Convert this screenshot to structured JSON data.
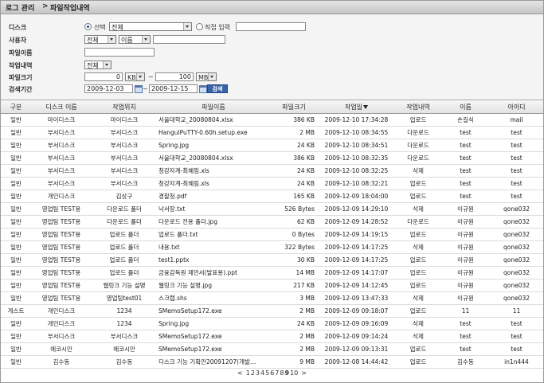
{
  "breadcrumb": {
    "parent": "로그 관리",
    "separator": ">",
    "current": "파일작업내역"
  },
  "filters": {
    "disk": {
      "label": "디스크",
      "radio_select_label": "선택",
      "select_value": "전체",
      "radio_direct_label": "직접 입력",
      "direct_value": ""
    },
    "user": {
      "label": "사용자",
      "scope_value": "전체",
      "field_value": "이름",
      "value": ""
    },
    "filename": {
      "label": "파일이름",
      "value": ""
    },
    "action": {
      "label": "작업내역",
      "value": "전체"
    },
    "filesize": {
      "label": "파일크기",
      "min": "0",
      "min_unit": "KB",
      "tilde": "~",
      "max": "100",
      "max_unit": "MB"
    },
    "period": {
      "label": "검색기간",
      "from": "2009-12-03",
      "tilde": "~",
      "to": "2009-12-15",
      "search_button": "검색"
    }
  },
  "table": {
    "columns": [
      "구분",
      "디스크 이름",
      "작업위치",
      "파일이름",
      "파일크기",
      "작업일",
      "작업내역",
      "이름",
      "아이디"
    ],
    "sort_column": "작업일",
    "sort_direction": "descending",
    "rows": [
      [
        "일반",
        "마이디스크",
        "마이디스크",
        "서울대학교_20080804.xlsx",
        "386 KB",
        "2009-12-10 17:34:28",
        "업로드",
        "손길식",
        "mail"
      ],
      [
        "일반",
        "부서디스크",
        "부서디스크",
        "HangulPuTTY-0.60h.setup.exe",
        "2 MB",
        "2009-12-10 08:34:55",
        "다운로드",
        "test",
        "test"
      ],
      [
        "일반",
        "부서디스크",
        "부서디스크",
        "Spring.jpg",
        "24 KB",
        "2009-12-10 08:34:51",
        "다운로드",
        "test",
        "test"
      ],
      [
        "일반",
        "부서디스크",
        "부서디스크",
        "서울대학교_20080804.xlsx",
        "386 KB",
        "2009-12-10 08:32:35",
        "다운로드",
        "test",
        "test"
      ],
      [
        "일반",
        "부서디스크",
        "부서디스크",
        "청강자계-최혜림.xls",
        "24 KB",
        "2009-12-10 08:32:25",
        "삭제",
        "test",
        "test"
      ],
      [
        "일반",
        "부서디스크",
        "부서디스크",
        "청강자계-최혜림.xls",
        "24 KB",
        "2009-12-10 08:32:21",
        "업로드",
        "test",
        "test"
      ],
      [
        "일반",
        "개인디스크",
        "김상구",
        "경찰청.pdf",
        "165 KB",
        "2009-12-09 18:04:00",
        "업로드",
        "test",
        "test"
      ],
      [
        "일반",
        "영업팀 TEST용",
        "다운로드 폴더",
        "낙서장.txt",
        "526 Bytes",
        "2009-12-09 14:29:10",
        "삭제",
        "이규원",
        "qone032"
      ],
      [
        "일반",
        "영업팀 TEST용",
        "다운로드 폴더",
        "다운로드 전용 폴더.jpg",
        "62 KB",
        "2009-12-09 14:28:52",
        "다운로드",
        "이규원",
        "qone032"
      ],
      [
        "일반",
        "영업팀 TEST용",
        "업로드 폴더",
        "업로드 폴더.txt",
        "0 Bytes",
        "2009-12-09 14:19:15",
        "업로드",
        "이규원",
        "qone032"
      ],
      [
        "일반",
        "영업팀 TEST용",
        "업로드 폴더",
        "내용.txt",
        "322 Bytes",
        "2009-12-09 14:17:25",
        "삭제",
        "이규원",
        "qone032"
      ],
      [
        "일반",
        "영업팀 TEST용",
        "업로드 폴더",
        "test1.pptx",
        "30 KB",
        "2009-12-09 14:17:25",
        "업로드",
        "이규원",
        "qone032"
      ],
      [
        "일반",
        "영업팀 TEST용",
        "업로드 폴더",
        "금융감독원 제안서(발표용).ppt",
        "14 MB",
        "2009-12-09 14:17:07",
        "업로드",
        "이규원",
        "qone032"
      ],
      [
        "일반",
        "영업팀 TEST용",
        "웹링크 기능 설명",
        "웹링크 기능 설명.jpg",
        "217 KB",
        "2009-12-09 14:12:45",
        "업로드",
        "이규원",
        "qone032"
      ],
      [
        "일반",
        "영업팀 TEST용",
        "영업팀test01",
        "스크랩.shs",
        "3 MB",
        "2009-12-09 13:47:33",
        "삭제",
        "이규원",
        "qone032"
      ],
      [
        "게스트",
        "개인디스크",
        "1234",
        "SMemoSetup172.exe",
        "2 MB",
        "2009-12-09 09:18:07",
        "업로드",
        "11",
        "11"
      ],
      [
        "일반",
        "개인디스크",
        "1234",
        "Spring.jpg",
        "24 KB",
        "2009-12-09 09:16:09",
        "삭제",
        "test",
        "test"
      ],
      [
        "일반",
        "부서디스크",
        "부서디스크",
        "SMemoSetup172.exe",
        "2 MB",
        "2009-12-09 09:14:24",
        "삭제",
        "test",
        "test"
      ],
      [
        "일반",
        "에코시안",
        "에코시안",
        "SMemoSetup172.exe",
        "2 MB",
        "2009-12-09 09:13:31",
        "업로드",
        "test",
        "test"
      ],
      [
        "일반",
        "김수동",
        "김수동",
        "디스크 기능 기획안20091207(개발…",
        "9 MB",
        "2009-12-08 14:44:42",
        "업로드",
        "김수동",
        "in1n444"
      ]
    ]
  },
  "pager": {
    "prev": "<",
    "pages": [
      "1",
      "2",
      "3",
      "4",
      "5",
      "6",
      "7",
      "8",
      "9",
      "10"
    ],
    "current": "9",
    "next": ">"
  },
  "colors": {
    "header_bg": "#e3e3e3",
    "filter_bg": "#f4f4f4",
    "button_blue": "#3a63a8",
    "radio_selected": "#1a4f9e"
  },
  "icons": {
    "calendar": "calendar-icon",
    "sort": "sort-desc-icon",
    "dropdown": "chevron-down-icon"
  }
}
